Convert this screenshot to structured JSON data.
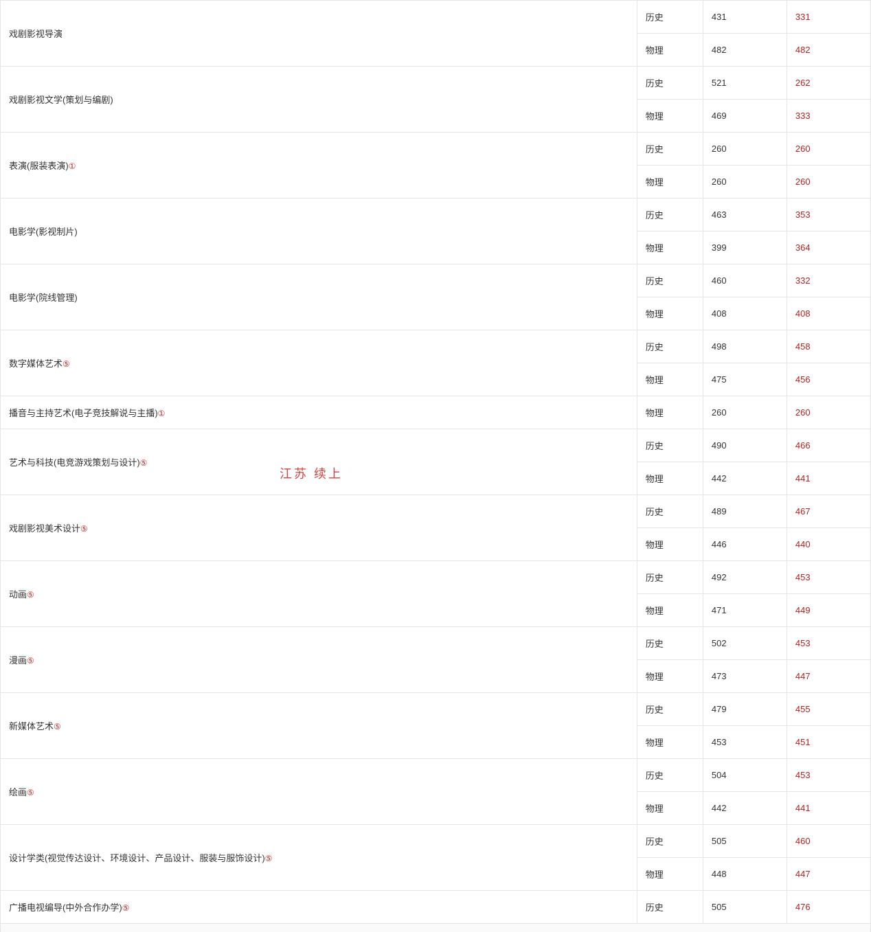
{
  "overlay": "江苏  续上",
  "rows": [
    {
      "major": "戏剧影视导演",
      "sup": "",
      "subrows": [
        {
          "s": "历史",
          "a": "431",
          "b": "331"
        },
        {
          "s": "物理",
          "a": "482",
          "b": "482"
        }
      ]
    },
    {
      "major": "戏剧影视文学(策划与编剧)",
      "sup": "",
      "subrows": [
        {
          "s": "历史",
          "a": "521",
          "b": "262"
        },
        {
          "s": "物理",
          "a": "469",
          "b": "333"
        }
      ]
    },
    {
      "major": "表演(服装表演)",
      "sup": "①",
      "subrows": [
        {
          "s": "历史",
          "a": "260",
          "b": "260"
        },
        {
          "s": "物理",
          "a": "260",
          "b": "260"
        }
      ]
    },
    {
      "major": "电影学(影视制片)",
      "sup": "",
      "subrows": [
        {
          "s": "历史",
          "a": "463",
          "b": "353"
        },
        {
          "s": "物理",
          "a": "399",
          "b": "364"
        }
      ]
    },
    {
      "major": "电影学(院线管理)",
      "sup": "",
      "subrows": [
        {
          "s": "历史",
          "a": "460",
          "b": "332"
        },
        {
          "s": "物理",
          "a": "408",
          "b": "408"
        }
      ]
    },
    {
      "major": "数字媒体艺术",
      "sup": "⑤",
      "subrows": [
        {
          "s": "历史",
          "a": "498",
          "b": "458"
        },
        {
          "s": "物理",
          "a": "475",
          "b": "456"
        }
      ]
    },
    {
      "major": "播音与主持艺术(电子竞技解说与主播)",
      "sup": "①",
      "subrows": [
        {
          "s": "物理",
          "a": "260",
          "b": "260"
        }
      ]
    },
    {
      "major": "艺术与科技(电竞游戏策划与设计)",
      "sup": "⑤",
      "subrows": [
        {
          "s": "历史",
          "a": "490",
          "b": "466"
        },
        {
          "s": "物理",
          "a": "442",
          "b": "441"
        }
      ]
    },
    {
      "major": "戏剧影视美术设计",
      "sup": "⑤",
      "subrows": [
        {
          "s": "历史",
          "a": "489",
          "b": "467"
        },
        {
          "s": "物理",
          "a": "446",
          "b": "440"
        }
      ]
    },
    {
      "major": "动画",
      "sup": "⑤",
      "subrows": [
        {
          "s": "历史",
          "a": "492",
          "b": "453"
        },
        {
          "s": "物理",
          "a": "471",
          "b": "449"
        }
      ]
    },
    {
      "major": "漫画",
      "sup": "⑤",
      "subrows": [
        {
          "s": "历史",
          "a": "502",
          "b": "453"
        },
        {
          "s": "物理",
          "a": "473",
          "b": "447"
        }
      ]
    },
    {
      "major": "新媒体艺术",
      "sup": "⑤",
      "subrows": [
        {
          "s": "历史",
          "a": "479",
          "b": "455"
        },
        {
          "s": "物理",
          "a": "453",
          "b": "451"
        }
      ]
    },
    {
      "major": "绘画",
      "sup": "⑤",
      "subrows": [
        {
          "s": "历史",
          "a": "504",
          "b": "453"
        },
        {
          "s": "物理",
          "a": "442",
          "b": "441"
        }
      ]
    },
    {
      "major": "设计学类(视觉传达设计、环境设计、产品设计、服装与服饰设计)",
      "sup": "⑤",
      "subrows": [
        {
          "s": "历史",
          "a": "505",
          "b": "460"
        },
        {
          "s": "物理",
          "a": "448",
          "b": "447"
        }
      ]
    },
    {
      "major": "广播电视编导(中外合作办学)",
      "sup": "⑤",
      "subrows": [
        {
          "s": "历史",
          "a": "505",
          "b": "476"
        }
      ]
    }
  ]
}
